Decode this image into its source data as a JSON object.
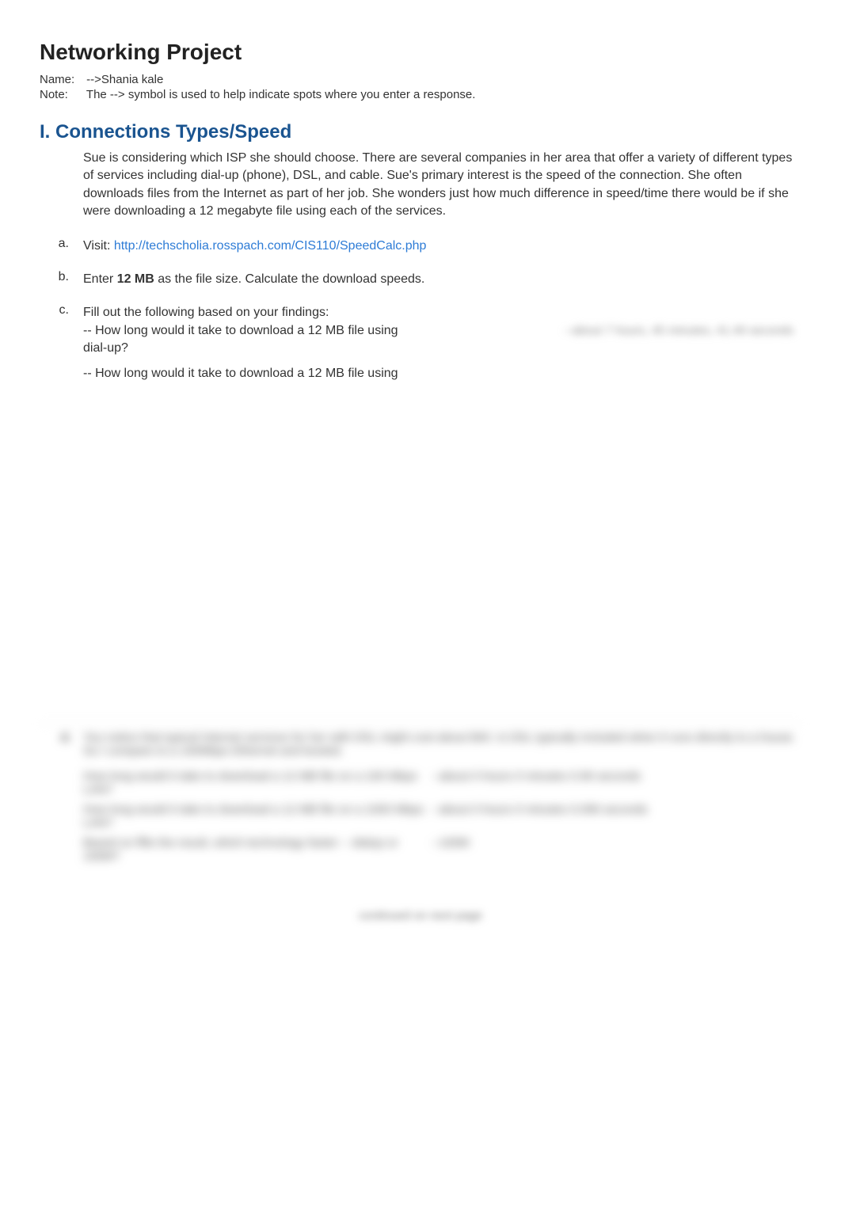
{
  "title": "Networking Project",
  "meta": {
    "name_label": "Name:",
    "name_value": "-->Shania kale",
    "note_label": "Note:",
    "note_value": "The -->  symbol is used to help indicate spots where you enter a response."
  },
  "section1": {
    "header": "I.  Connections Types/Speed",
    "intro": "Sue is considering which ISP she should choose.   There are several companies in her area that offer a variety of different types of services including dial-up (phone), DSL, and cable.  Sue's primary interest is the speed of the connection.  She often downloads files from the Internet as part of her job.   She wonders just how much difference in speed/time there would be if she were downloading a 12 megabyte file using each of the services.",
    "items": {
      "a_label": "a.",
      "a_prefix": "Visit:  ",
      "a_link": "http://techscholia.rosspach.com/CIS110/SpeedCalc.php",
      "b_label": "b.",
      "b_prefix": "Enter ",
      "b_bold": "12 MB",
      "b_suffix": " as the file size.  Calculate the download speeds.",
      "c_label": "c.",
      "c_intro": "Fill out the following based on your findings:",
      "c_q1": "-- How long would it take to download a 12 MB file using dial-up?",
      "c_q1_ans": "--about 7 hours, 45 minutes, 41.49 seconds",
      "c_q2": "-- How long would it take to download a 12 MB file using"
    }
  },
  "blurred": {
    "d_label": "d.",
    "d_text": "You notice that typical Internet services for her with DSL might cost about $40.    Is DSL typically included when it runs directly to a house.  So I compare to a 100Mbps Ethernet and booted.",
    "q1": "How long would it take to download a 12 MB file on a 100 Mbps LAN?",
    "q1_ans": "--about 0 hours 0 minutes 0.96 seconds",
    "q2": "How long would it take to download a 12 MB file on a 1000 Mbps LAN?",
    "q2_ans": "--about 0 hours 0 minutes 0.096 seconds",
    "q3": "Based on ffile the result, which technology faster -- dialup or 100M?",
    "q3_ans": "--100M"
  },
  "footer": "continued on next page"
}
